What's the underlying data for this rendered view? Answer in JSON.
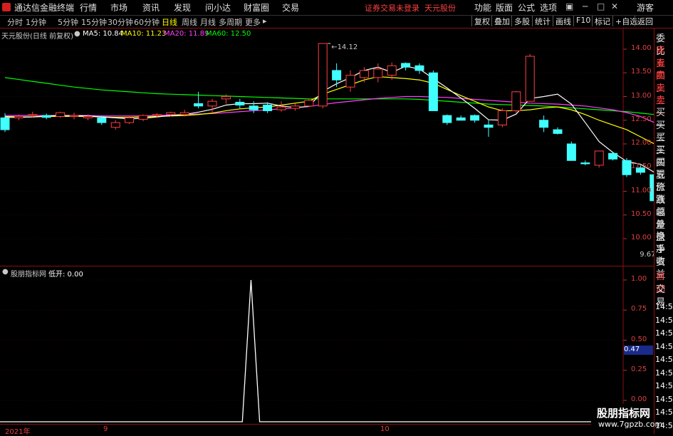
{
  "menu": {
    "app_title": "通达信金融终端",
    "items": [
      "行情",
      "市场",
      "资讯",
      "发现",
      "问小达",
      "财富圈",
      "交易"
    ],
    "notice_prefix": "证券交易未登录",
    "stock_name": "天元股份",
    "right_items": [
      "功能",
      "版面",
      "公式",
      "选项"
    ],
    "user": "游客"
  },
  "tabs": {
    "periods": [
      "分时",
      "1分钟",
      "5分钟",
      "15分钟",
      "30分钟",
      "60分钟",
      "日线",
      "周线",
      "月线",
      "多周期",
      "更多"
    ],
    "active": "日线",
    "tools": [
      "复权",
      "叠加",
      "多股",
      "统计",
      "画线",
      "F10",
      "标记",
      "+自选",
      "返回"
    ]
  },
  "legend": {
    "title": "天元股份(日线 前复权)",
    "ma5": "MA5: 10.84",
    "ma10": "MA10: 11.23",
    "ma20": "MA20: 11.89",
    "ma60": "MA60: 12.50",
    "colors": {
      "ma5": "#ffffff",
      "ma10": "#ffff00",
      "ma20": "#ff40ff",
      "ma60": "#00ff00",
      "up": "#ff4040",
      "down": "#40ffff"
    }
  },
  "sub": {
    "title": "股朋指标网",
    "indicator": "低开: 0.00",
    "cursor_value": "0.47"
  },
  "rightpanel": {
    "labels": [
      "委比",
      "卖五",
      "卖四",
      "卖三",
      "卖二",
      "卖一",
      "买一",
      "买二",
      "买三",
      "买四",
      "买五",
      "现价",
      "涨跌",
      "涨幅",
      "总量",
      "外盘",
      "换手",
      "净资",
      "收益"
    ],
    "lower": [
      "自动",
      "交易"
    ],
    "times": [
      "14:56",
      "14:56",
      "14:56",
      "14:56",
      "14:56",
      "14:56",
      "14:56",
      "14:56",
      "14:56",
      "14:5"
    ]
  },
  "xaxis": {
    "labels": [
      "2021年",
      "9",
      "10"
    ]
  },
  "watermark": {
    "line1": "股朋指标网",
    "line2": "www.7gpzb.com"
  },
  "chart_data": [
    {
      "type": "candlestick",
      "title": "天元股份(日线 前复权)",
      "ylim": [
        9.5,
        14.2
      ],
      "y_ticks": [
        10.0,
        10.5,
        11.0,
        11.5,
        12.0,
        12.5,
        13.0,
        13.5,
        14.0
      ],
      "annotations": [
        {
          "text": "14.12",
          "value": 14.12
        },
        {
          "text": "9.67",
          "value": 9.67
        }
      ],
      "ohlc": [
        [
          12.55,
          12.65,
          12.25,
          12.3
        ],
        [
          12.55,
          12.62,
          12.5,
          12.58
        ],
        [
          12.6,
          12.68,
          12.55,
          12.62
        ],
        [
          12.6,
          12.64,
          12.52,
          12.56
        ],
        [
          12.58,
          12.68,
          12.55,
          12.66
        ],
        [
          12.58,
          12.66,
          12.52,
          12.6
        ],
        [
          12.55,
          12.62,
          12.5,
          12.58
        ],
        [
          12.55,
          12.6,
          12.4,
          12.45
        ],
        [
          12.35,
          12.5,
          12.3,
          12.45
        ],
        [
          12.45,
          12.6,
          12.42,
          12.55
        ],
        [
          12.52,
          12.62,
          12.48,
          12.6
        ],
        [
          12.6,
          12.65,
          12.55,
          12.62
        ],
        [
          12.62,
          12.68,
          12.58,
          12.66
        ],
        [
          12.62,
          12.72,
          12.58,
          12.66
        ],
        [
          12.85,
          13.1,
          12.75,
          12.8
        ],
        [
          12.8,
          12.95,
          12.65,
          12.9
        ],
        [
          12.95,
          13.05,
          12.85,
          13.0
        ],
        [
          12.88,
          12.95,
          12.75,
          12.82
        ],
        [
          12.8,
          12.9,
          12.65,
          12.72
        ],
        [
          12.82,
          12.88,
          12.65,
          12.7
        ],
        [
          12.72,
          12.9,
          12.68,
          12.78
        ],
        [
          12.75,
          12.85,
          12.7,
          12.8
        ],
        [
          12.8,
          12.95,
          12.78,
          12.92
        ],
        [
          12.8,
          14.12,
          12.75,
          14.12
        ],
        [
          13.55,
          13.7,
          13.2,
          13.35
        ],
        [
          13.2,
          13.55,
          13.1,
          13.45
        ],
        [
          13.4,
          13.62,
          13.3,
          13.55
        ],
        [
          13.4,
          13.7,
          13.3,
          13.58
        ],
        [
          13.45,
          13.72,
          13.35,
          13.65
        ],
        [
          13.7,
          13.72,
          13.55,
          13.62
        ],
        [
          13.65,
          13.7,
          13.48,
          13.55
        ],
        [
          13.5,
          13.55,
          12.7,
          12.7
        ],
        [
          12.6,
          12.62,
          12.4,
          12.45
        ],
        [
          12.55,
          12.6,
          12.5,
          12.5
        ],
        [
          12.6,
          12.62,
          12.45,
          12.5
        ],
        [
          12.4,
          12.5,
          12.15,
          12.35
        ],
        [
          12.4,
          12.75,
          12.35,
          12.7
        ],
        [
          12.7,
          13.12,
          12.65,
          13.1
        ],
        [
          12.9,
          13.9,
          12.9,
          13.85
        ],
        [
          12.5,
          12.6,
          12.25,
          12.35
        ],
        [
          12.3,
          12.35,
          12.2,
          12.22
        ],
        [
          12.0,
          12.05,
          11.65,
          11.65
        ],
        [
          11.6,
          11.65,
          11.55,
          11.58
        ],
        [
          11.55,
          11.85,
          11.5,
          11.85
        ],
        [
          11.8,
          11.82,
          11.65,
          11.68
        ],
        [
          11.65,
          11.7,
          11.3,
          11.35
        ],
        [
          11.5,
          11.55,
          11.35,
          11.4
        ],
        [
          11.35,
          11.35,
          10.7,
          10.8
        ],
        [
          9.67,
          11.05,
          9.67,
          11.05
        ],
        [
          10.85,
          10.95,
          10.7,
          10.75
        ],
        [
          10.95,
          10.95,
          10.45,
          10.45
        ]
      ],
      "ma5": [
        12.58,
        12.57,
        12.57,
        12.59,
        12.6,
        12.6,
        12.59,
        12.57,
        12.55,
        12.53,
        12.54,
        12.57,
        12.6,
        12.62,
        12.67,
        12.73,
        12.82,
        12.85,
        12.85,
        12.86,
        12.8,
        12.77,
        12.79,
        13.11,
        13.27,
        13.4,
        13.55,
        13.62,
        13.51,
        13.64,
        13.58,
        13.38,
        13.18,
        12.97,
        12.75,
        12.51,
        12.5,
        12.63,
        12.96,
        13.0,
        13.05,
        12.84,
        12.45,
        12.05,
        11.82,
        11.63,
        11.57,
        11.4,
        11.38,
        11.18,
        10.84
      ],
      "ma10": [
        12.56,
        12.56,
        12.57,
        12.58,
        12.58,
        12.58,
        12.58,
        12.57,
        12.56,
        12.56,
        12.57,
        12.58,
        12.59,
        12.6,
        12.62,
        12.65,
        12.7,
        12.74,
        12.76,
        12.78,
        12.82,
        12.86,
        12.9,
        13.05,
        13.15,
        13.25,
        13.35,
        13.42,
        13.4,
        13.38,
        13.35,
        13.28,
        13.15,
        13.02,
        12.9,
        12.78,
        12.7,
        12.7,
        12.72,
        12.76,
        12.78,
        12.72,
        12.62,
        12.5,
        12.4,
        12.3,
        12.15,
        12.0,
        11.82,
        11.55,
        11.23
      ],
      "ma20": [
        12.6,
        12.6,
        12.6,
        12.6,
        12.6,
        12.6,
        12.6,
        12.59,
        12.59,
        12.59,
        12.59,
        12.6,
        12.61,
        12.62,
        12.63,
        12.64,
        12.66,
        12.68,
        12.7,
        12.72,
        12.74,
        12.76,
        12.79,
        12.83,
        12.87,
        12.9,
        12.93,
        12.96,
        12.98,
        13.0,
        13.0,
        12.99,
        12.98,
        12.96,
        12.94,
        12.92,
        12.9,
        12.88,
        12.86,
        12.85,
        12.84,
        12.82,
        12.8,
        12.76,
        12.72,
        12.66,
        12.58,
        12.45,
        12.3,
        12.12,
        11.89
      ],
      "ma60": [
        13.4,
        13.36,
        13.32,
        13.28,
        13.24,
        13.2,
        13.17,
        13.14,
        13.12,
        13.1,
        13.08,
        13.06,
        13.05,
        13.04,
        13.03,
        13.02,
        13.01,
        13.0,
        12.99,
        12.98,
        12.97,
        12.96,
        12.95,
        12.95,
        12.95,
        12.95,
        12.95,
        12.95,
        12.95,
        12.95,
        12.94,
        12.92,
        12.9,
        12.88,
        12.86,
        12.84,
        12.83,
        12.82,
        12.81,
        12.8,
        12.78,
        12.76,
        12.74,
        12.72,
        12.7,
        12.68,
        12.65,
        12.62,
        12.58,
        12.55,
        12.5
      ]
    },
    {
      "type": "line",
      "title": "股朋指标网 低开",
      "ylim": [
        0,
        1
      ],
      "y_ticks": [
        0.0,
        0.25,
        0.5,
        0.75,
        1.0
      ],
      "values": [
        0,
        0,
        0,
        0,
        0,
        0,
        0,
        0,
        0,
        0,
        0,
        0,
        0,
        0,
        0,
        0,
        0,
        0,
        0,
        0,
        0,
        0,
        0,
        0,
        0,
        0,
        0,
        0,
        0,
        1,
        0,
        0,
        0,
        0,
        0,
        0,
        0,
        0,
        0,
        0,
        0,
        0,
        0,
        0,
        0,
        0,
        0,
        0,
        0,
        0,
        0,
        0,
        0,
        0,
        0,
        0,
        0,
        0,
        0,
        0,
        0,
        0,
        0,
        0,
        0,
        0,
        0,
        0,
        0,
        0,
        0,
        0,
        0
      ]
    }
  ]
}
